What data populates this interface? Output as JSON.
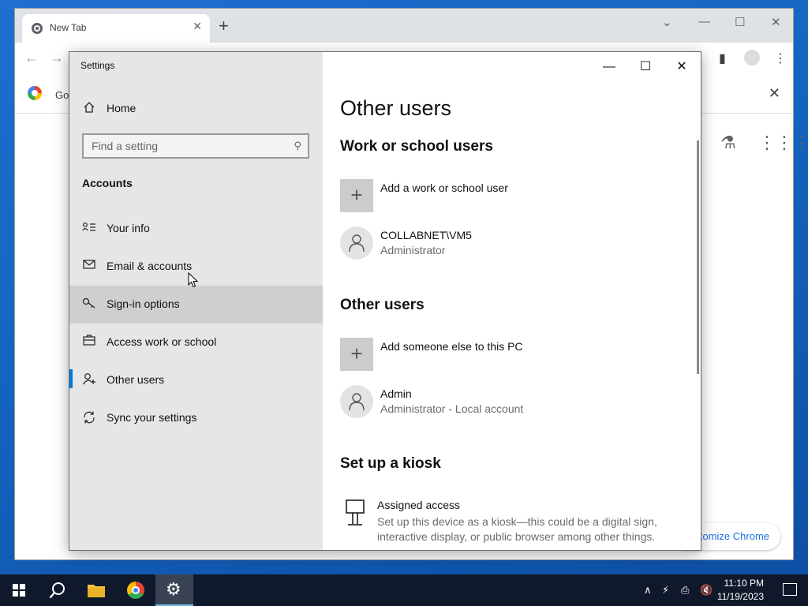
{
  "chrome": {
    "tab_title": "New Tab",
    "tab_close": "✕",
    "new_tab": "+",
    "bookmark_text": "Go",
    "bookmark_close": "✕",
    "customize_label": "ıstomize Chrome"
  },
  "settings": {
    "app_title": "Settings",
    "titlebar": {
      "minimize": "—",
      "maximize": "☐",
      "close": "✕"
    },
    "sidebar": {
      "home_label": "Home",
      "search_placeholder": "Find a setting",
      "section_label": "Accounts",
      "items": [
        {
          "label": "Your info",
          "icon": "your-info-icon"
        },
        {
          "label": "Email & accounts",
          "icon": "mail-icon"
        },
        {
          "label": "Sign-in options",
          "icon": "key-icon"
        },
        {
          "label": "Access work or school",
          "icon": "briefcase-icon"
        },
        {
          "label": "Other users",
          "icon": "add-person-icon"
        },
        {
          "label": "Sync your settings",
          "icon": "sync-icon"
        }
      ],
      "selected_item": "Other users",
      "hovered_item": "Sign-in options"
    },
    "content": {
      "page_title": "Other users",
      "work_section": {
        "heading": "Work or school users",
        "add_label": "Add a work or school user",
        "user_name": "COLLABNET\\VM5",
        "user_role": "Administrator"
      },
      "other_section": {
        "heading": "Other users",
        "add_label": "Add someone else to this PC",
        "user_name": "Admin",
        "user_role": "Administrator - Local account"
      },
      "kiosk_section": {
        "heading": "Set up a kiosk",
        "title": "Assigned access",
        "description": "Set up this device as a kiosk—this could be a digital sign, interactive display, or public browser among other things."
      }
    }
  },
  "taskbar": {
    "time": "11:10 PM",
    "date": "11/19/2023",
    "pinned": [
      "start-button",
      "search-button",
      "file-explorer-button",
      "chrome-button",
      "settings-button"
    ],
    "active": "settings-button"
  },
  "colors": {
    "accent": "#0078d7",
    "sidebar_bg": "#e6e6e6",
    "taskbar_bg": "#10192b",
    "chrome_link": "#1a73e8"
  }
}
